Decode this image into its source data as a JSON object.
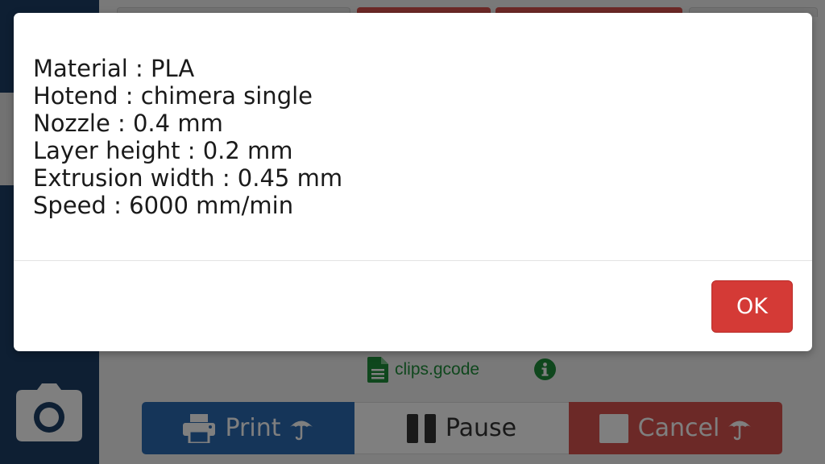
{
  "dialog": {
    "lines": [
      "Material : PLA",
      "Hotend : chimera single",
      "Nozzle : 0.4 mm",
      "Layer height : 0.2 mm",
      "Extrusion width : 0.45 mm",
      "Speed : 6000 mm/min"
    ],
    "ok_label": "OK"
  },
  "file": {
    "name": "clips.gcode",
    "file_icon": "file-document-icon",
    "info_icon": "info-circle-icon"
  },
  "actions": {
    "print_label": "Print",
    "pause_label": "Pause",
    "cancel_label": "Cancel"
  },
  "sidebar": {
    "camera_icon": "camera-icon"
  },
  "colors": {
    "sidebar": "#1c3f66",
    "print": "#2b6bb3",
    "cancel": "#d9534f",
    "ok": "#d43a36",
    "file_text": "#1f8f3a"
  }
}
